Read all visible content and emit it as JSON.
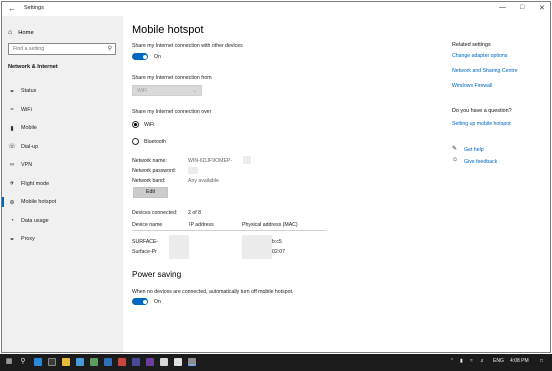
{
  "window": {
    "title": "Settings",
    "back_icon": "back-arrow-icon",
    "controls": [
      "minimize-icon",
      "maximize-icon",
      "close-icon"
    ]
  },
  "sidebar": {
    "home_label": "Home",
    "search_placeholder": "Find a setting",
    "section_title": "Network & Internet",
    "items": [
      {
        "label": "Status",
        "icon": "globe-icon"
      },
      {
        "label": "WiFi",
        "icon": "wifi-icon"
      },
      {
        "label": "Mobile",
        "icon": "cellular-icon"
      },
      {
        "label": "Dial-up",
        "icon": "phone-icon"
      },
      {
        "label": "VPN",
        "icon": "vpn-icon"
      },
      {
        "label": "Flight mode",
        "icon": "airplane-icon"
      },
      {
        "label": "Mobile hotspot",
        "icon": "hotspot-icon"
      },
      {
        "label": "Data usage",
        "icon": "data-usage-icon"
      },
      {
        "label": "Proxy",
        "icon": "proxy-globe-icon"
      }
    ],
    "active_index": 6
  },
  "main": {
    "title": "Mobile hotspot",
    "share_label": "Share my Internet connection with other devices",
    "share_toggle": "On",
    "share_from_label": "Share my Internet connection from",
    "share_from_value": "WiFi",
    "share_over_label": "Share my Internet connection over",
    "share_over_options": [
      "WiFi",
      "Bluetooth"
    ],
    "share_over_selected": "WiFi",
    "network_name_label": "Network name:",
    "network_name_value": "WIN-6DJF9OMEP-",
    "network_password_label": "Network password:",
    "network_band_label": "Network band:",
    "network_band_value": "Any available",
    "edit_label": "Edit",
    "devices_connected_label": "Devices connected:",
    "devices_connected_value": "2 of 8",
    "table_headers": [
      "Device name",
      "IP address",
      "Physical address (MAC)"
    ],
    "devices": [
      {
        "name": "SURFACE-",
        "mac_tail": "b:c5"
      },
      {
        "name": "Surface-Pr",
        "mac_tail": "02:07"
      }
    ],
    "power_saving_title": "Power saving",
    "power_saving_label": "When no devices are connected, automatically turn off mobile hotspot.",
    "power_saving_toggle": "On"
  },
  "related": {
    "title": "Related settings",
    "links": [
      "Change adapter options",
      "Network and Sharing Centre",
      "Windows Firewall"
    ],
    "question_title": "Do you have a question?",
    "question_link": "Setting up mobile hotspot",
    "help_label": "Get help",
    "feedback_label": "Give feedback"
  },
  "taskbar": {
    "language": "ENG",
    "time": "4:08 PM",
    "accent": "#1c1c1c"
  },
  "colors": {
    "accent": "#0067c0",
    "sidebar_bg": "#f0f0f0"
  }
}
